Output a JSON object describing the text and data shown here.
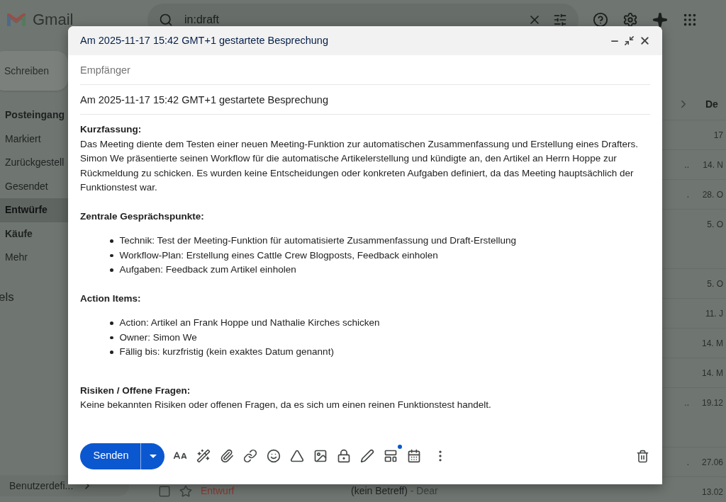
{
  "app_header": {
    "logo_text": "Gmail",
    "search": {
      "value": "in:draft"
    }
  },
  "sidebar": {
    "compose_button": "Schreiben",
    "items": [
      {
        "label": "Posteingang",
        "unread": true,
        "selected": false
      },
      {
        "label": "Markiert",
        "unread": false,
        "selected": false
      },
      {
        "label": "Zurückgestell",
        "unread": false,
        "selected": false
      },
      {
        "label": "Gesendet",
        "unread": false,
        "selected": false
      },
      {
        "label": "Entwürfe",
        "unread": true,
        "selected": true
      },
      {
        "label": "Käufe",
        "unread": true,
        "selected": false
      },
      {
        "label": "Mehr",
        "unread": false,
        "selected": false
      }
    ],
    "section_label": "els",
    "bottom_item": "Benutzerdefi..."
  },
  "message_list": {
    "column_header": "De",
    "rows": [
      {
        "kind": "standard",
        "date": "17"
      },
      {
        "kind": "standard",
        "date": "14. N",
        "tail": ".."
      },
      {
        "kind": "standard",
        "date": "28. O",
        "tail": "."
      },
      {
        "kind": "tall",
        "date": "5. O"
      },
      {
        "kind": "standard",
        "date": "5. O"
      },
      {
        "kind": "standard",
        "date": "11. J"
      },
      {
        "kind": "standard",
        "date": "14. M"
      },
      {
        "kind": "standard",
        "date": "14. M"
      },
      {
        "kind": "tall",
        "date": "19.12",
        "tail": ".."
      },
      {
        "kind": "standard",
        "date": "27.06",
        "tail": "."
      },
      {
        "kind": "standard",
        "date": "13.02",
        "checked": false,
        "sender": "Entwurf",
        "subject": "(kein Betreff)",
        "snippet": "- Dear"
      }
    ]
  },
  "compose": {
    "title": "Am 2025-11-17 15:42 GMT+1 gestartete Besprechung",
    "to": {
      "placeholder": "Empfänger"
    },
    "subject": "Am 2025-11-17 15:42 GMT+1 gestartete Besprechung",
    "sections": [
      {
        "heading": "Kurzfassung:",
        "paragraph": "Das Meeting diente dem Testen einer neuen Meeting-Funktion zur automatischen Zusammenfassung und Erstellung eines Drafters. Simon We präsentierte seinen Workflow für die automatische Artikelerstellung und kündigte an, den Artikel an Herrn Hoppe zur Rückmeldung zu schicken. Es wurden keine Entscheidungen oder konkreten Aufgaben definiert, da das Meeting hauptsächlich der Funktionstest war."
      },
      {
        "heading": "Zentrale Gesprächspunkte:",
        "bullets": [
          "Technik: Test der Meeting-Funktion für automatisierte Zusammenfassung und Draft-Erstellung",
          "Workflow-Plan: Erstellung eines Cattle Crew Blogposts, Feedback einholen",
          "Aufgaben: Feedback zum Artikel einholen"
        ]
      },
      {
        "heading": "Action Items:",
        "bullets": [
          "Action: Artikel an Frank Hoppe und Nathalie Kirches schicken",
          "Owner: Simon We",
          "Fällig bis: kurzfristig (kein exaktes Datum genannt)"
        ]
      },
      {
        "heading": "Risiken / Offene Fragen:",
        "paragraph": "Keine bekannten Risiken oder offenen Fragen, da es sich um einen reinen Funktionstest handelt."
      }
    ],
    "send_button": "Senden"
  }
}
